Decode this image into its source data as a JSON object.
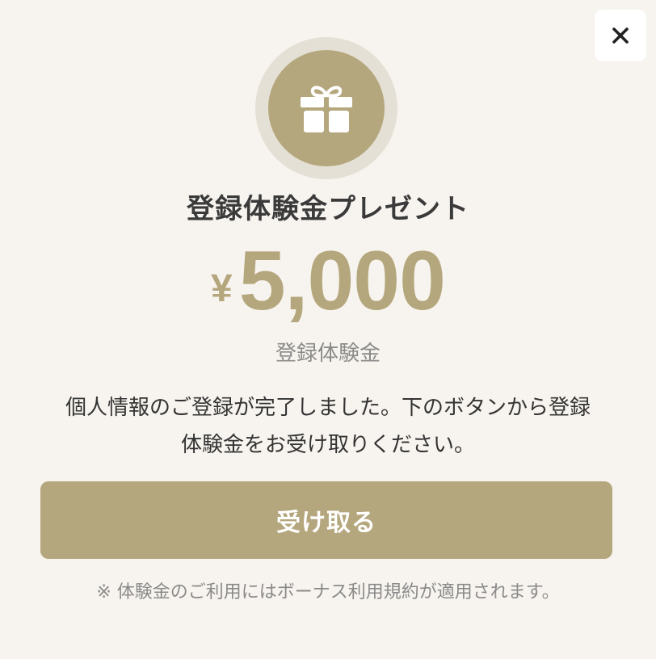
{
  "colors": {
    "background": "#f7f4ef",
    "accent": "#b5a77d",
    "halo": "#e5e0d5",
    "text": "#333333",
    "muted": "#8a8a8a",
    "button_text": "#ffffff"
  },
  "dialog": {
    "close_icon": "close-icon",
    "gift_icon": "gift-icon",
    "title": "登録体験金プレゼント",
    "currency_symbol": "¥",
    "amount": "5,000",
    "amount_caption": "登録体験金",
    "description_line1": "個人情報のご登録が完了しました。下のボタンから登録",
    "description_line2": "体験金をお受け取りください。",
    "receive_button_label": "受け取る",
    "note": "※ 体験金のご利用にはボーナス利用規約が適用されます。"
  }
}
